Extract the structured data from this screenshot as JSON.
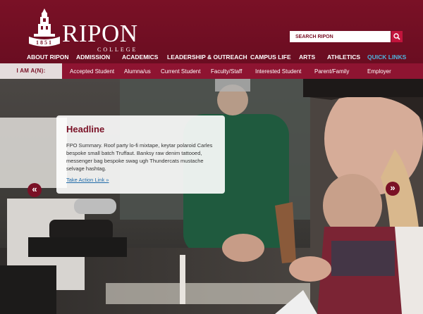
{
  "brand": {
    "name": "RIPON",
    "subtitle": "COLLEGE",
    "seal_year": "1851"
  },
  "search": {
    "placeholder": "SEARCH RIPON",
    "icon": "search-icon"
  },
  "main_nav": [
    {
      "label": "ABOUT RIPON"
    },
    {
      "label": "ADMISSION"
    },
    {
      "label": "ACADEMICS"
    },
    {
      "label": "LEADERSHIP & OUTREACH"
    },
    {
      "label": "CAMPUS LIFE"
    },
    {
      "label": "ARTS"
    },
    {
      "label": "ATHLETICS"
    },
    {
      "label": "QUICK LINKS"
    }
  ],
  "audience": {
    "label": "I AM A(N):",
    "items": [
      {
        "label": "Accepted Student"
      },
      {
        "label": "Alumna/us"
      },
      {
        "label": "Current Student"
      },
      {
        "label": "Faculty/Staff"
      },
      {
        "label": "Interested Student"
      },
      {
        "label": "Parent/Family"
      },
      {
        "label": "Employer"
      }
    ]
  },
  "hero": {
    "headline": "Headline",
    "summary": "FPO Summary. Roof party lo-fi mixtape, keytar polaroid Carles bespoke small batch Truffaut. Banksy raw denim tattooed, messenger bag bespoke swag ugh Thundercats mustache selvage hashtag.",
    "link": "Take Action Link »",
    "prev_arrow": "«",
    "next_arrow": "»"
  },
  "colors": {
    "maroon": "#7a1126",
    "audience_bar": "#8e1431",
    "quick_links": "#4fb3dc",
    "link": "#1f6aa8"
  }
}
